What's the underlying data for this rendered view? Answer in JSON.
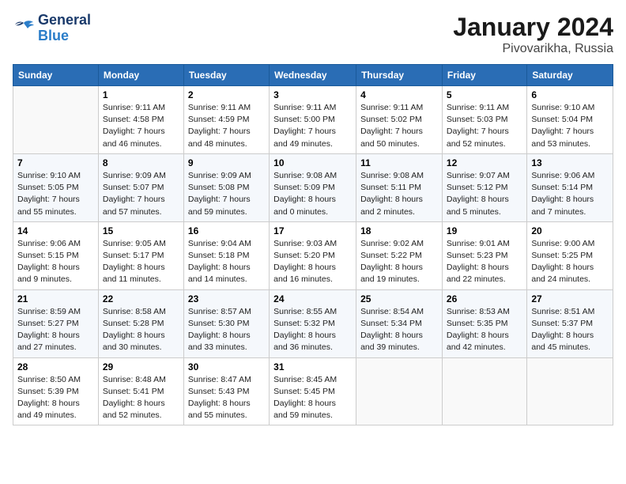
{
  "logo": {
    "line1": "General",
    "line2": "Blue"
  },
  "title": "January 2024",
  "subtitle": "Pivovarikha, Russia",
  "header_days": [
    "Sunday",
    "Monday",
    "Tuesday",
    "Wednesday",
    "Thursday",
    "Friday",
    "Saturday"
  ],
  "weeks": [
    [
      {
        "day": "",
        "info": ""
      },
      {
        "day": "1",
        "info": "Sunrise: 9:11 AM\nSunset: 4:58 PM\nDaylight: 7 hours\nand 46 minutes."
      },
      {
        "day": "2",
        "info": "Sunrise: 9:11 AM\nSunset: 4:59 PM\nDaylight: 7 hours\nand 48 minutes."
      },
      {
        "day": "3",
        "info": "Sunrise: 9:11 AM\nSunset: 5:00 PM\nDaylight: 7 hours\nand 49 minutes."
      },
      {
        "day": "4",
        "info": "Sunrise: 9:11 AM\nSunset: 5:02 PM\nDaylight: 7 hours\nand 50 minutes."
      },
      {
        "day": "5",
        "info": "Sunrise: 9:11 AM\nSunset: 5:03 PM\nDaylight: 7 hours\nand 52 minutes."
      },
      {
        "day": "6",
        "info": "Sunrise: 9:10 AM\nSunset: 5:04 PM\nDaylight: 7 hours\nand 53 minutes."
      }
    ],
    [
      {
        "day": "7",
        "info": "Sunrise: 9:10 AM\nSunset: 5:05 PM\nDaylight: 7 hours\nand 55 minutes."
      },
      {
        "day": "8",
        "info": "Sunrise: 9:09 AM\nSunset: 5:07 PM\nDaylight: 7 hours\nand 57 minutes."
      },
      {
        "day": "9",
        "info": "Sunrise: 9:09 AM\nSunset: 5:08 PM\nDaylight: 7 hours\nand 59 minutes."
      },
      {
        "day": "10",
        "info": "Sunrise: 9:08 AM\nSunset: 5:09 PM\nDaylight: 8 hours\nand 0 minutes."
      },
      {
        "day": "11",
        "info": "Sunrise: 9:08 AM\nSunset: 5:11 PM\nDaylight: 8 hours\nand 2 minutes."
      },
      {
        "day": "12",
        "info": "Sunrise: 9:07 AM\nSunset: 5:12 PM\nDaylight: 8 hours\nand 5 minutes."
      },
      {
        "day": "13",
        "info": "Sunrise: 9:06 AM\nSunset: 5:14 PM\nDaylight: 8 hours\nand 7 minutes."
      }
    ],
    [
      {
        "day": "14",
        "info": "Sunrise: 9:06 AM\nSunset: 5:15 PM\nDaylight: 8 hours\nand 9 minutes."
      },
      {
        "day": "15",
        "info": "Sunrise: 9:05 AM\nSunset: 5:17 PM\nDaylight: 8 hours\nand 11 minutes."
      },
      {
        "day": "16",
        "info": "Sunrise: 9:04 AM\nSunset: 5:18 PM\nDaylight: 8 hours\nand 14 minutes."
      },
      {
        "day": "17",
        "info": "Sunrise: 9:03 AM\nSunset: 5:20 PM\nDaylight: 8 hours\nand 16 minutes."
      },
      {
        "day": "18",
        "info": "Sunrise: 9:02 AM\nSunset: 5:22 PM\nDaylight: 8 hours\nand 19 minutes."
      },
      {
        "day": "19",
        "info": "Sunrise: 9:01 AM\nSunset: 5:23 PM\nDaylight: 8 hours\nand 22 minutes."
      },
      {
        "day": "20",
        "info": "Sunrise: 9:00 AM\nSunset: 5:25 PM\nDaylight: 8 hours\nand 24 minutes."
      }
    ],
    [
      {
        "day": "21",
        "info": "Sunrise: 8:59 AM\nSunset: 5:27 PM\nDaylight: 8 hours\nand 27 minutes."
      },
      {
        "day": "22",
        "info": "Sunrise: 8:58 AM\nSunset: 5:28 PM\nDaylight: 8 hours\nand 30 minutes."
      },
      {
        "day": "23",
        "info": "Sunrise: 8:57 AM\nSunset: 5:30 PM\nDaylight: 8 hours\nand 33 minutes."
      },
      {
        "day": "24",
        "info": "Sunrise: 8:55 AM\nSunset: 5:32 PM\nDaylight: 8 hours\nand 36 minutes."
      },
      {
        "day": "25",
        "info": "Sunrise: 8:54 AM\nSunset: 5:34 PM\nDaylight: 8 hours\nand 39 minutes."
      },
      {
        "day": "26",
        "info": "Sunrise: 8:53 AM\nSunset: 5:35 PM\nDaylight: 8 hours\nand 42 minutes."
      },
      {
        "day": "27",
        "info": "Sunrise: 8:51 AM\nSunset: 5:37 PM\nDaylight: 8 hours\nand 45 minutes."
      }
    ],
    [
      {
        "day": "28",
        "info": "Sunrise: 8:50 AM\nSunset: 5:39 PM\nDaylight: 8 hours\nand 49 minutes."
      },
      {
        "day": "29",
        "info": "Sunrise: 8:48 AM\nSunset: 5:41 PM\nDaylight: 8 hours\nand 52 minutes."
      },
      {
        "day": "30",
        "info": "Sunrise: 8:47 AM\nSunset: 5:43 PM\nDaylight: 8 hours\nand 55 minutes."
      },
      {
        "day": "31",
        "info": "Sunrise: 8:45 AM\nSunset: 5:45 PM\nDaylight: 8 hours\nand 59 minutes."
      },
      {
        "day": "",
        "info": ""
      },
      {
        "day": "",
        "info": ""
      },
      {
        "day": "",
        "info": ""
      }
    ]
  ]
}
